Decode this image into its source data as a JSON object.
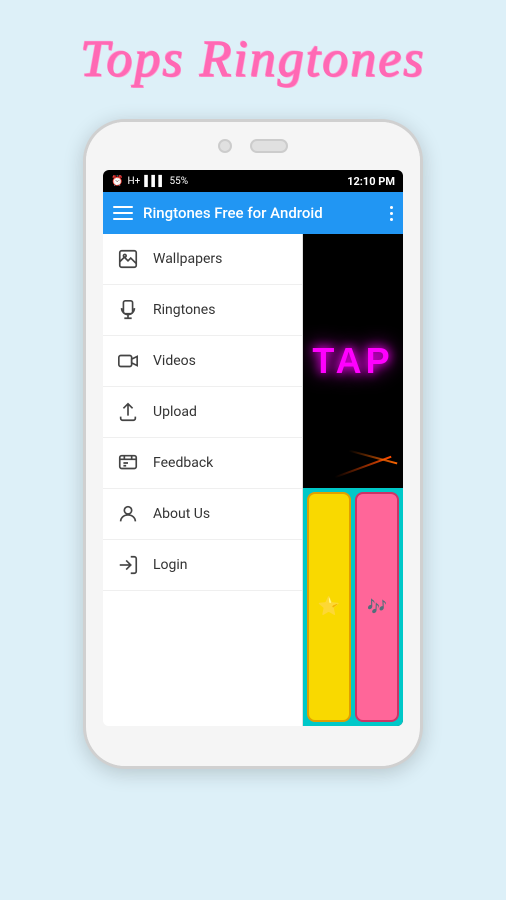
{
  "header": {
    "title": "Tops Ringtones"
  },
  "statusBar": {
    "alarm": "⏰",
    "hplus": "H+",
    "signal": "▌▌▌",
    "battery": "55%",
    "time": "12:10 PM"
  },
  "appBar": {
    "title": "Ringtones Free for Android",
    "moreLabel": "⋮"
  },
  "menu": {
    "items": [
      {
        "id": "wallpapers",
        "label": "Wallpapers",
        "icon": "image"
      },
      {
        "id": "ringtones",
        "label": "Ringtones",
        "icon": "music"
      },
      {
        "id": "videos",
        "label": "Videos",
        "icon": "video"
      },
      {
        "id": "upload",
        "label": "Upload",
        "icon": "upload"
      },
      {
        "id": "feedback",
        "label": "Feedback",
        "icon": "feedback"
      },
      {
        "id": "aboutus",
        "label": "About Us",
        "icon": "person"
      },
      {
        "id": "login",
        "label": "Login",
        "icon": "login"
      }
    ]
  },
  "rightPanel": {
    "tapText": "TAP"
  }
}
